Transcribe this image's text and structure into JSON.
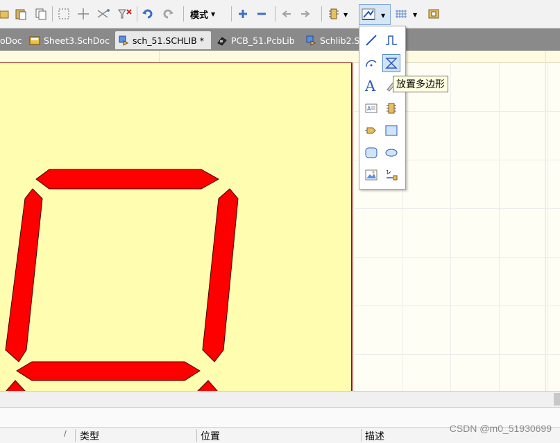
{
  "toolbar": {
    "mode_label": "模式",
    "icons": [
      "open-folder-icon",
      "paste-icon",
      "copy-icon",
      "select-rect-icon",
      "move-icon",
      "cut-wires-icon",
      "clear-filter-icon",
      "undo-icon",
      "redo-icon",
      "mode-dropdown",
      "add-icon",
      "remove-icon",
      "prev-icon",
      "next-icon",
      "component-icon",
      "drawing-tools-icon",
      "grid-icon",
      "library-icon"
    ]
  },
  "tabs": [
    {
      "label": "oDoc"
    },
    {
      "label": "Sheet3.SchDoc"
    },
    {
      "label": "sch_51.SCHLIB *"
    },
    {
      "label": "PCB_51.PcbLib"
    },
    {
      "label": "Schlib2.S"
    }
  ],
  "dropdown": {
    "items": [
      "line",
      "bezier",
      "arc",
      "polygon",
      "text",
      "text-frame-tool",
      "note",
      "part",
      "port",
      "rectangle",
      "round-rectangle",
      "ellipse",
      "image",
      "array-paste"
    ],
    "tooltip": "放置多边形"
  },
  "bottom": {
    "columns": [
      "类型",
      "位置",
      "描述"
    ],
    "sort_indicator": "/"
  },
  "watermark": "CSDN @m0_51930699",
  "colors": {
    "segment": "#ff0000",
    "sheet": "#fffdb0",
    "border": "#8b1a1a"
  }
}
